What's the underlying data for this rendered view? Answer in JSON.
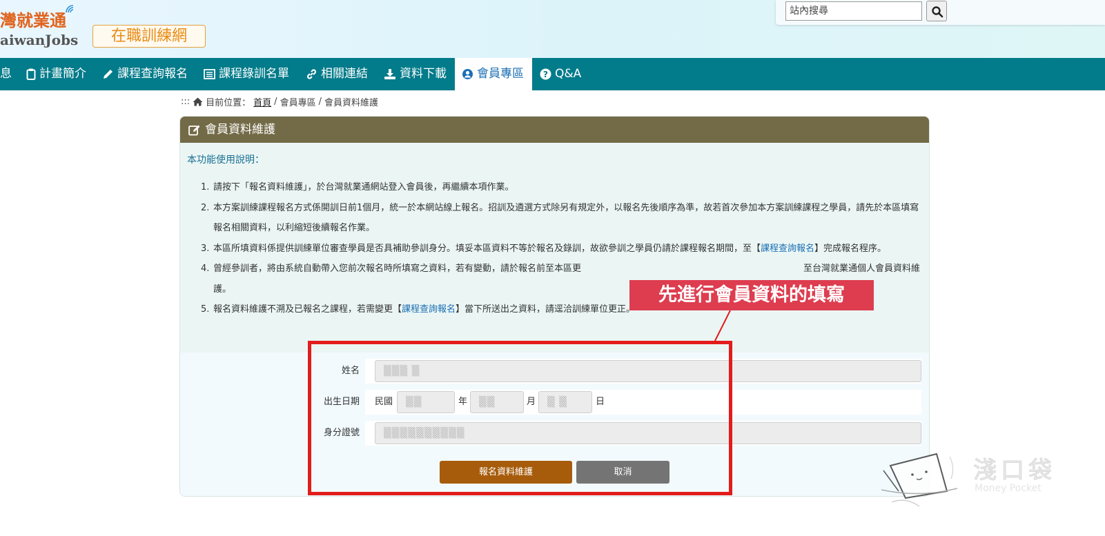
{
  "header": {
    "logo_main": "灣就業通",
    "logo_sub": "aiwanJobs",
    "site_name": "在職訓練網",
    "search_placeholder": "站內搜尋"
  },
  "nav": {
    "items": [
      {
        "label": "息",
        "icon": "none"
      },
      {
        "label": "計畫簡介",
        "icon": "clipboard-icon"
      },
      {
        "label": "課程查詢報名",
        "icon": "pencil-icon"
      },
      {
        "label": "課程錄訓名單",
        "icon": "list-icon"
      },
      {
        "label": "相關連結",
        "icon": "link-icon"
      },
      {
        "label": "資料下載",
        "icon": "download-icon"
      },
      {
        "label": "會員專區",
        "icon": "user-circle-icon",
        "active": true
      },
      {
        "label": "Q&A",
        "icon": "question-circle-icon"
      }
    ]
  },
  "breadcrumb": {
    "prefix": ":::",
    "label": "目前位置：",
    "home": "首頁",
    "sep1": "/",
    "member": "會員專區",
    "sep2": "/",
    "current": "會員資料維護"
  },
  "panel": {
    "title": "會員資料維護",
    "intro": "本功能使用說明：",
    "notes": [
      {
        "num": "1.",
        "parts": [
          {
            "t": "請按下「報名資料維護」，於台灣就業通網站登入會員後，再繼續本項作業。"
          }
        ]
      },
      {
        "num": "2.",
        "parts": [
          {
            "t": "本方案訓練課程報名方式係開訓日前1個月，統一於本網站線上報名。招訓及遴選方式除另有規定外，以報名先後順序為準，故若首次參加本方案訓練課程之學員，請先於本區填寫報名相關資料，以利縮短後續報名作業。"
          }
        ]
      },
      {
        "num": "3.",
        "parts": [
          {
            "t": "本區所填資料係提供訓練單位審查學員是否具補助參訓身分。填妥本區資料不等於報名及錄訓，故欲參訓之學員仍請於課程報名期間，至【"
          },
          {
            "t": "課程查詢報名",
            "link": true
          },
          {
            "t": "】完成報名程序。"
          }
        ]
      },
      {
        "num": "4.",
        "parts": [
          {
            "t": "曾經參訓者，將由系統自動帶入您前次報名時所填寫之資料，若有變動，請於報名前至本區更"
          },
          {
            "t": "至台灣就業通個人會員資料維護。",
            "gap": true
          }
        ]
      },
      {
        "num": "5.",
        "parts": [
          {
            "t": "報名資料維護不溯及已報名之課程，若需變更【"
          },
          {
            "t": "課程查詢報名",
            "link": true
          },
          {
            "t": "】當下所送出之資料，請逕洽訓練單位更正。"
          }
        ]
      }
    ],
    "form": {
      "name_label": "姓名",
      "name_value": "▒▒▒ ▒",
      "birth_label": "出生日期",
      "birth_prefix": "民國",
      "birth_year": "▒▒",
      "birth_year_unit": "年",
      "birth_month": "▒▒",
      "birth_month_unit": "月",
      "birth_day": "▒ ▒",
      "birth_day_unit": "日",
      "id_label": "身分證號",
      "id_value": "▒▒▒▒▒▒▒▒▒▒"
    },
    "buttons": {
      "submit": "報名資料維護",
      "cancel": "取消"
    }
  },
  "annotation": {
    "callout": "先進行會員資料的填寫",
    "highlight_color": "#e21c1c",
    "callout_color": "#dd3d4f"
  },
  "watermark": {
    "title": "淺口袋",
    "subtitle": "Money Pocket"
  },
  "colors": {
    "nav_bg": "#027b8a",
    "panel_head": "#736b47",
    "submit_btn": "#a75c0b",
    "cancel_btn": "#747474"
  }
}
